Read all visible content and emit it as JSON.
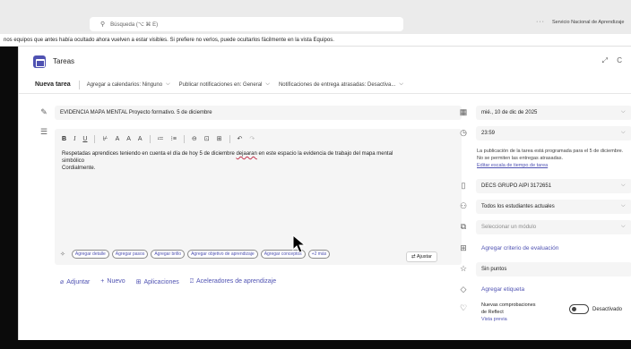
{
  "topbar": {
    "search_placeholder": "Búsqueda (⌥ ⌘ E)",
    "more": "···",
    "org_name": "Servicio Nacional de Aprendizaje"
  },
  "banner": "nos equipos que antes había ocultado ahora vuelven a estar visibles. Si prefiere no verlos, puede ocultarlos fácilmente en la vista Equipos.",
  "header": {
    "title": "Tareas",
    "actions": "⤢ C"
  },
  "toolbar": {
    "nueva": "Nueva tarea",
    "calendar": "Agregar a calendarios: Ninguno",
    "publish": "Publicar notificaciones en: General",
    "late": "Notificaciones de entrega atrasadas: Desactiva..."
  },
  "assignment": {
    "title": "EVIDENCIA MAPA MENTAL Proyecto formativo. 5 de diciembre",
    "body_before": "Respetadas aprendices teniendo en cuenta el día de hoy 5 de diciembre ",
    "body_misspelled": "dejaaran",
    "body_after": " en este espacio la evidencia de trabajo del mapa mental",
    "body_line2": "simbólico",
    "body_line3": "Cordialmente."
  },
  "format_bar": [
    "B",
    "I",
    "U",
    "⊬",
    "A",
    "A",
    "A",
    "≔",
    "⁝≡",
    "⊖",
    "⊡",
    "⊞",
    "↶",
    "↷"
  ],
  "pills": [
    "Agregar detalle",
    "Agregar pasos",
    "Agregar brillo",
    "Agregar objetivo de aprendizaje",
    "Agregar conceptos",
    "+2 más"
  ],
  "ajustar": "⇄ Ajustar",
  "attachments": {
    "adjuntar": "Adjuntar",
    "nuevo": "Nuevo",
    "aplicaciones": "Aplicaciones",
    "aceleradores": "Aceleradores de aprendizaje"
  },
  "right": {
    "date": "mié., 10 de dic de 2025",
    "time": "23:59",
    "schedule_note": "La publicación de la tarea está programada para el 5 de diciembre. No se permiten las entregas atrasadas.",
    "schedule_link": "Editar escala de tiempo de tarea",
    "group": "DECS GRUPO AIPI 3172651",
    "students": "Todos los estudiantes actuales",
    "module": "Seleccionar un módulo",
    "criteria": "Agregar criterio de evaluación",
    "points": "Sin puntos",
    "tag": "Agregar etiqueta",
    "reflect_line1": "Nuevas comprobaciones",
    "reflect_line2": "de Reflect",
    "reflect_preview": "Vista previa",
    "reflect_state": "Desactivado"
  }
}
